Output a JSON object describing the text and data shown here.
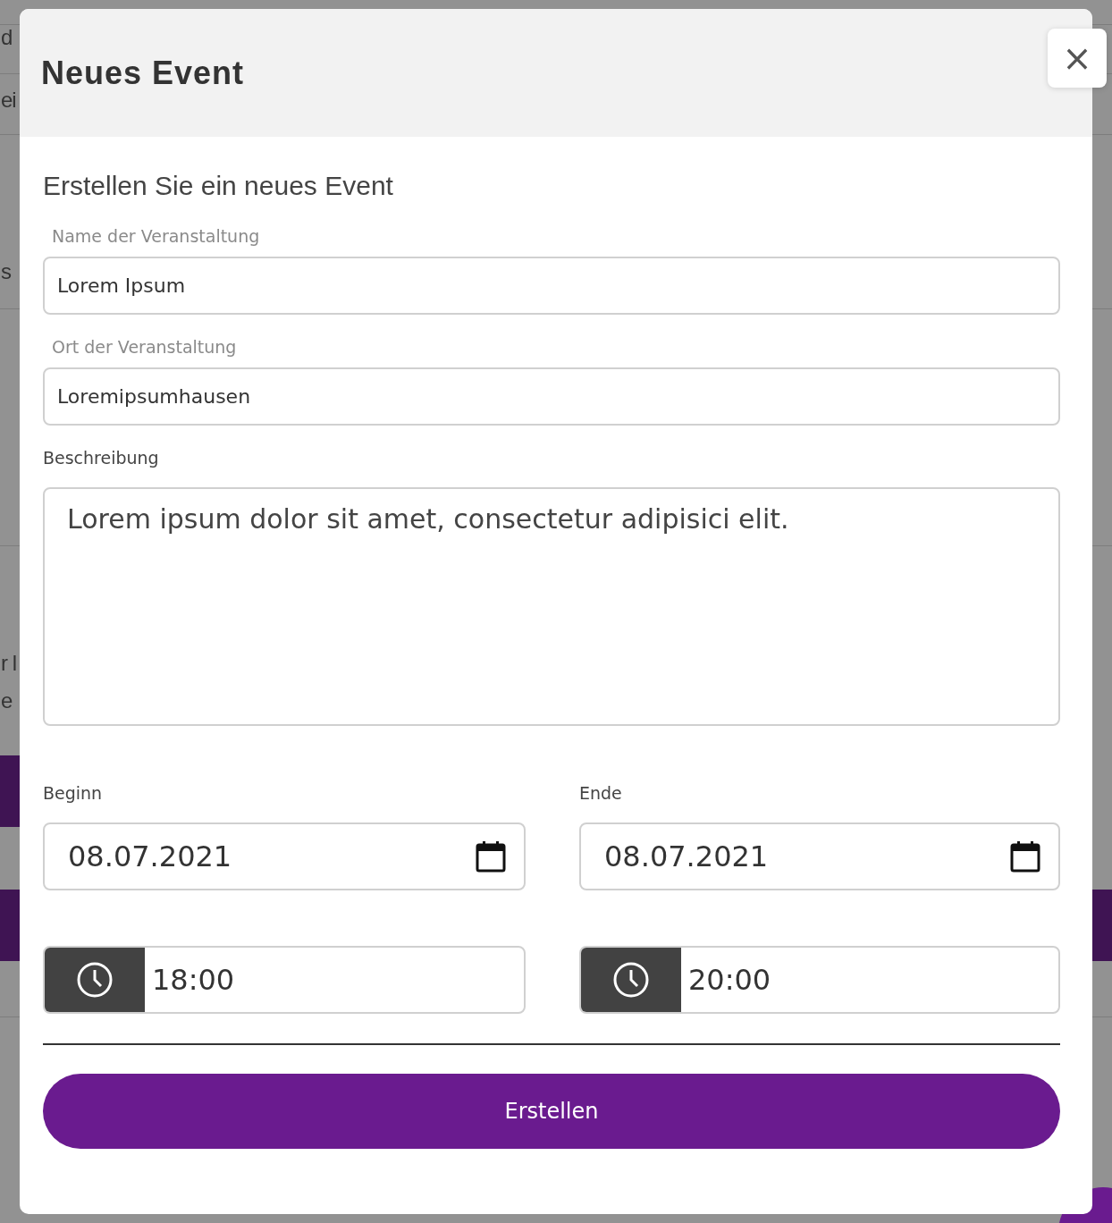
{
  "background": {
    "fragments": [
      "d",
      "ei",
      "s",
      "r l",
      "e"
    ]
  },
  "dialog": {
    "title": "Neues Event",
    "close_label": "×",
    "subtitle": "Erstellen Sie ein neues Event",
    "fields": [
      {
        "label": "Name der Veranstaltung",
        "value": "Lorem Ipsum"
      },
      {
        "label": "Ort der Veranstaltung",
        "value": "Loremipsumhausen"
      }
    ],
    "description": {
      "label": "Beschreibung",
      "value": "Lorem ipsum dolor sit amet, consectetur adipisici elit."
    },
    "columns": [
      {
        "label": "Beginn",
        "date": "08.07.2021",
        "time": "18:00"
      },
      {
        "label": "Ende",
        "date": "08.07.2021",
        "time": "20:00"
      }
    ],
    "submit": "Erstellen"
  }
}
